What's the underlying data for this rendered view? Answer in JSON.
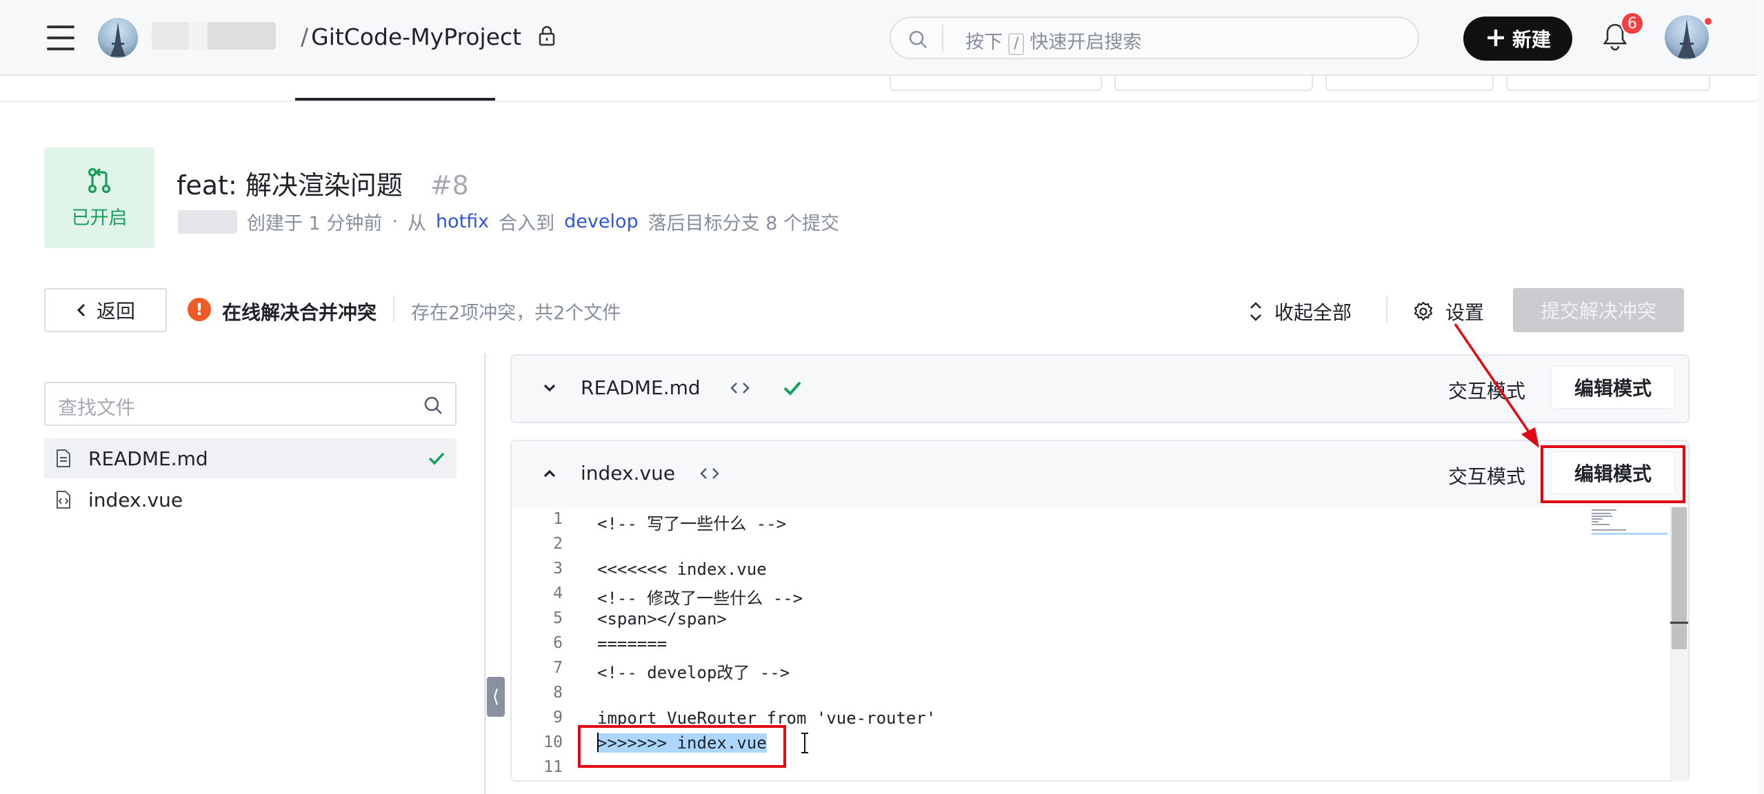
{
  "header": {
    "repo_path": "GitCode-MyProject",
    "search_placeholder_before": "按下",
    "search_key": "/",
    "search_placeholder_after": "快速开启搜索",
    "new_button_label": "新建",
    "notification_count": "6"
  },
  "merge_request": {
    "status": "已开启",
    "title": "feat: 解决渲染问题",
    "number": "#8",
    "created": "创建于 1 分钟前",
    "dot": "·",
    "from_label": "从",
    "source_branch": "hotfix",
    "into_label": "合入到",
    "target_branch": "develop",
    "behind_info": "落后目标分支 8 个提交"
  },
  "toolbar": {
    "back_label": "返回",
    "warning_glyph": "!",
    "conflict_title": "在线解决合并冲突",
    "conflict_info": "存在2项冲突，共2个文件",
    "collapse_all_label": "收起全部",
    "settings_label": "设置",
    "submit_label": "提交解决冲突"
  },
  "sidebar": {
    "search_placeholder": "查找文件",
    "files": [
      {
        "name": "README.md",
        "resolved": true
      },
      {
        "name": "index.vue",
        "resolved": false
      }
    ],
    "collapse_glyph": "⟨"
  },
  "panels": [
    {
      "file_name": "README.md",
      "expanded": false,
      "resolved": true,
      "interactive_mode_label": "交互模式",
      "edit_mode_label": "编辑模式"
    },
    {
      "file_name": "index.vue",
      "expanded": true,
      "resolved": false,
      "interactive_mode_label": "交互模式",
      "edit_mode_label": "编辑模式",
      "code_lines": [
        {
          "n": "1",
          "text": "<!-- 写了一些什么 -->"
        },
        {
          "n": "2",
          "text": ""
        },
        {
          "n": "3",
          "text": "<<<<<<< index.vue"
        },
        {
          "n": "4",
          "text": "<!-- 修改了一些什么 -->"
        },
        {
          "n": "5",
          "text": "<span></span>"
        },
        {
          "n": "6",
          "text": "======="
        },
        {
          "n": "7",
          "text": "<!-- develop改了 -->"
        },
        {
          "n": "8",
          "text": ""
        },
        {
          "n": "9",
          "text": "import VueRouter from 'vue-router'"
        },
        {
          "n": "10",
          "text": ">>>>>>> index.vue"
        },
        {
          "n": "11",
          "text": ""
        }
      ]
    }
  ],
  "colors": {
    "accent_green": "#1a9e5d",
    "branch_blue": "#2f56d4",
    "annotation_red": "#e30613",
    "warning_orange": "#f15a24"
  }
}
